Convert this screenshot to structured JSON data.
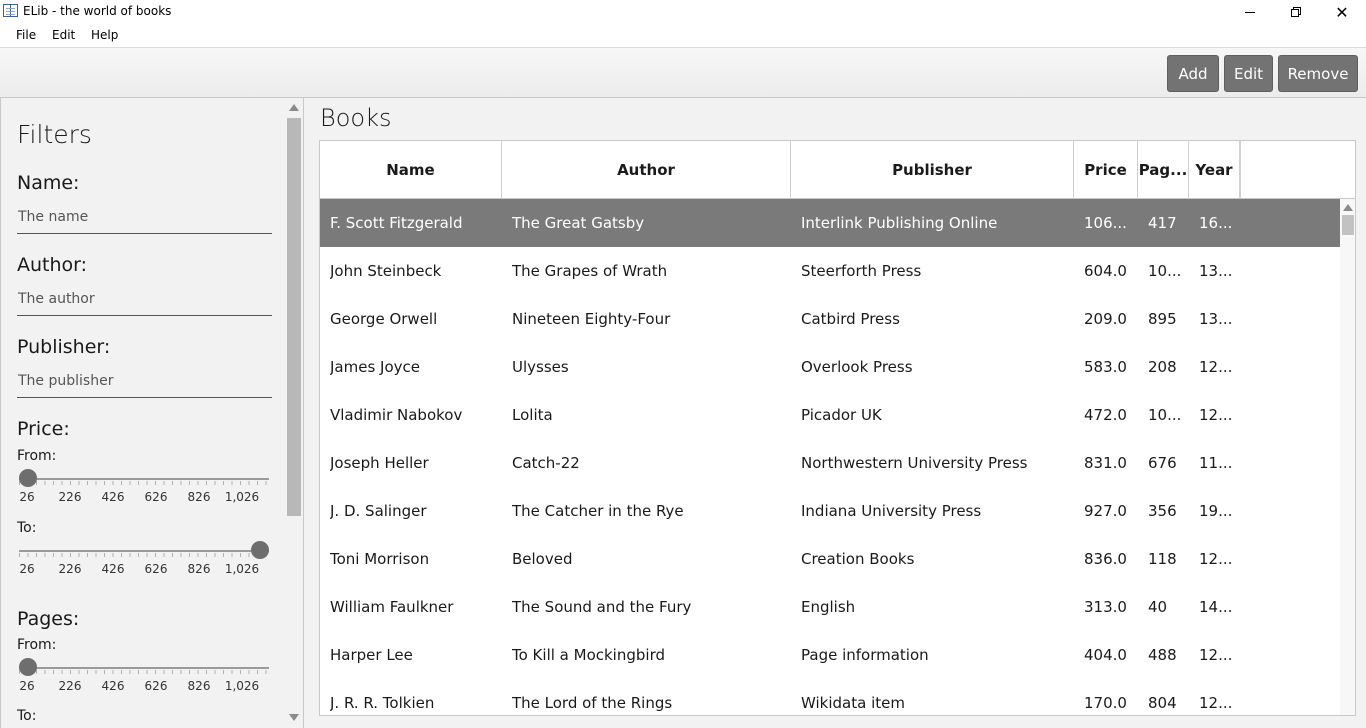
{
  "window": {
    "title": "ELib - the world of books",
    "icon": "book-icon"
  },
  "menu": [
    "File",
    "Edit",
    "Help"
  ],
  "toolbar": {
    "add_label": "Add",
    "edit_label": "Edit",
    "remove_label": "Remove"
  },
  "filters": {
    "title": "Filters",
    "name_label": "Name:",
    "name_placeholder": "The name",
    "author_label": "Author:",
    "author_placeholder": "The author",
    "publisher_label": "Publisher:",
    "publisher_placeholder": "The publisher",
    "price_label": "Price:",
    "from_label": "From:",
    "to_label": "To:",
    "pages_label": "Pages:",
    "tick_labels": [
      "26",
      "226",
      "426",
      "626",
      "826",
      "1,026"
    ],
    "price_from_value": 26,
    "price_to_value": 1026,
    "pages_from_value": 26
  },
  "books": {
    "title": "Books",
    "columns": [
      "Name",
      "Author",
      "Publisher",
      "Price",
      "Pag...",
      "Year"
    ],
    "rows": [
      [
        "F. Scott Fitzgerald",
        "The Great Gatsby",
        "Interlink Publishing Online",
        "106...",
        "417",
        "16..."
      ],
      [
        "John Steinbeck",
        "The Grapes of Wrath",
        "Steerforth Press",
        "604.0",
        "10...",
        "13..."
      ],
      [
        "George Orwell",
        "Nineteen Eighty-Four",
        "Catbird Press",
        "209.0",
        "895",
        "13..."
      ],
      [
        "James Joyce",
        "Ulysses",
        "Overlook Press",
        "583.0",
        "208",
        "12..."
      ],
      [
        "Vladimir Nabokov",
        "Lolita",
        "Picador UK",
        "472.0",
        "10...",
        "12..."
      ],
      [
        "Joseph Heller",
        "Catch-22",
        "Northwestern University Press",
        "831.0",
        "676",
        "11..."
      ],
      [
        "J. D. Salinger",
        "The Catcher in the Rye",
        "Indiana University Press",
        "927.0",
        "356",
        "19..."
      ],
      [
        "Toni Morrison",
        "Beloved",
        "Creation Books",
        "836.0",
        "118",
        "12..."
      ],
      [
        "William Faulkner",
        "The Sound and the Fury",
        "English",
        "313.0",
        "40",
        "14..."
      ],
      [
        "Harper Lee",
        "To Kill a Mockingbird",
        "Page information",
        "404.0",
        "488",
        "12..."
      ],
      [
        "J. R. R. Tolkien",
        "The Lord of the Rings",
        "Wikidata item",
        "170.0",
        "804",
        "12..."
      ]
    ],
    "selected_row": 0
  },
  "colors": {
    "button_bg": "#737373",
    "selected_row_bg": "#7a7a7a",
    "slider_thumb": "#6e6e6e"
  }
}
